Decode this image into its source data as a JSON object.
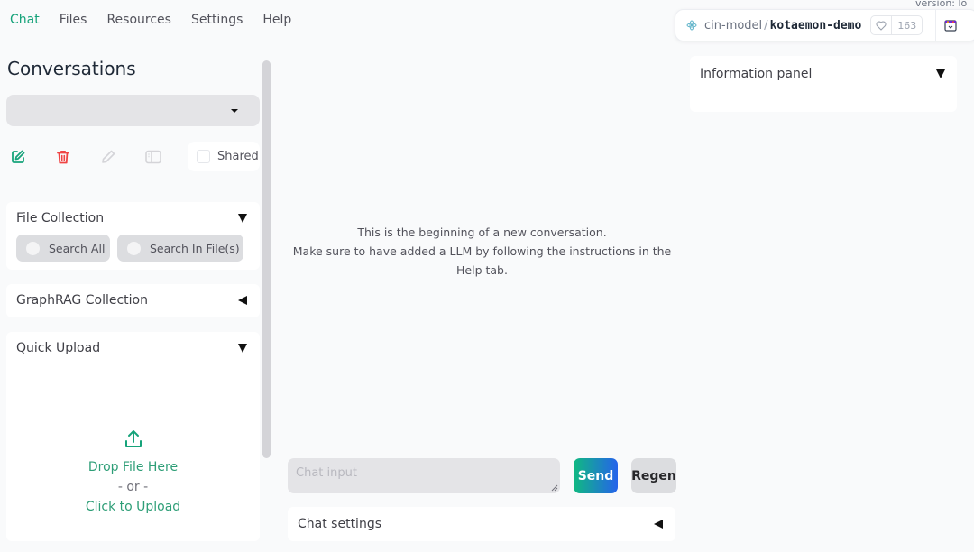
{
  "nav": {
    "tabs": [
      {
        "label": "Chat",
        "active": true
      },
      {
        "label": "Files",
        "active": false
      },
      {
        "label": "Resources",
        "active": false
      },
      {
        "label": "Settings",
        "active": false
      },
      {
        "label": "Help",
        "active": false
      }
    ]
  },
  "header": {
    "owner": "cin-model",
    "separator": "/",
    "repo": "kotaemon-demo",
    "likes": "163",
    "version_text": "version: lo"
  },
  "sidebar": {
    "title": "Conversations",
    "conversation_select": {
      "value": ""
    },
    "actions": {
      "new": "new-conversation",
      "delete": "delete-conversation",
      "rename": "rename-conversation",
      "toggle_panel": "toggle-panel"
    },
    "shared_label": "Shared",
    "shared_checked": false,
    "file_collection": {
      "title": "File Collection",
      "options": [
        "Search All",
        "Search In File(s)"
      ]
    },
    "graphrag_collection": {
      "title": "GraphRAG Collection"
    },
    "quick_upload": {
      "title": "Quick Upload",
      "drop_text": "Drop File Here",
      "or_text": "- or -",
      "click_text": "Click to Upload"
    }
  },
  "chat": {
    "welcome_line1": "This is the beginning of a new conversation.",
    "welcome_line2": "Make sure to have added a LLM by following the instructions in the Help tab.",
    "input_placeholder": "Chat input",
    "input_value": "",
    "send_label": "Send",
    "regen_label": "Regen",
    "settings_title": "Chat settings"
  },
  "info_panel": {
    "title": "Information panel"
  },
  "colors": {
    "accent": "#16a37a",
    "delete": "#ef4444",
    "send_gradient_start": "#10b981",
    "send_gradient_end": "#2563eb"
  }
}
